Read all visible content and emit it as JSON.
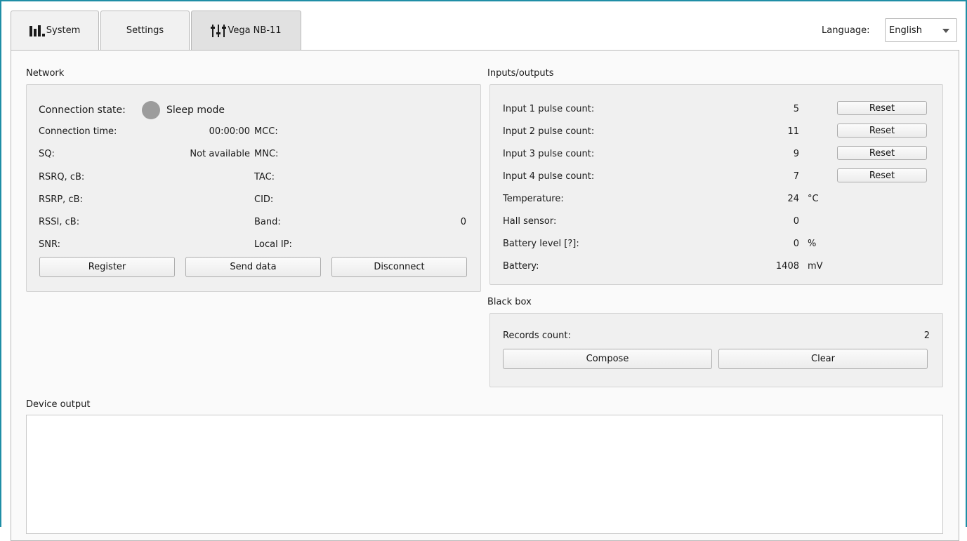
{
  "tabs": [
    {
      "label": "System",
      "icon": "bar-chart-icon"
    },
    {
      "label": "Settings",
      "icon": ""
    },
    {
      "label": "Vega NB-11",
      "icon": "sliders-icon"
    }
  ],
  "language": {
    "label": "Language:",
    "value": "English"
  },
  "network": {
    "title": "Network",
    "connection_state_label": "Connection state:",
    "connection_state_value": "Sleep mode",
    "status_color": "#9c9c9c",
    "fields": {
      "connection_time_label": "Connection time:",
      "connection_time_value": "00:00:00",
      "sq_label": "SQ:",
      "sq_value": "Not available",
      "rsrq_label": "RSRQ, cB:",
      "rsrp_label": "RSRP, cB:",
      "rssi_label": "RSSI, cB:",
      "snr_label": "SNR:",
      "mcc_label": "MCC:",
      "mnc_label": "MNC:",
      "tac_label": "TAC:",
      "cid_label": "CID:",
      "band_label": "Band:",
      "band_value": "0",
      "local_ip_label": "Local IP:"
    },
    "buttons": {
      "register": "Register",
      "send_data": "Send data",
      "disconnect": "Disconnect"
    }
  },
  "io": {
    "title": "Inputs/outputs",
    "rows": [
      {
        "label": "Input 1 pulse count:",
        "value": "5",
        "unit": "",
        "reset": "Reset"
      },
      {
        "label": "Input 2 pulse count:",
        "value": "11",
        "unit": "",
        "reset": "Reset"
      },
      {
        "label": "Input 3 pulse count:",
        "value": "9",
        "unit": "",
        "reset": "Reset"
      },
      {
        "label": "Input 4 pulse count:",
        "value": "7",
        "unit": "",
        "reset": "Reset"
      },
      {
        "label": "Temperature:",
        "value": "24",
        "unit": "°C"
      },
      {
        "label": "Hall sensor:",
        "value": "0",
        "unit": ""
      },
      {
        "label": "Battery level [?]:",
        "value": "0",
        "unit": "%"
      },
      {
        "label": "Battery:",
        "value": "1408",
        "unit": "mV"
      }
    ]
  },
  "blackbox": {
    "title": "Black box",
    "records_label": "Records count:",
    "records_value": "2",
    "compose": "Compose",
    "clear": "Clear"
  },
  "device_output": {
    "title": "Device output"
  }
}
